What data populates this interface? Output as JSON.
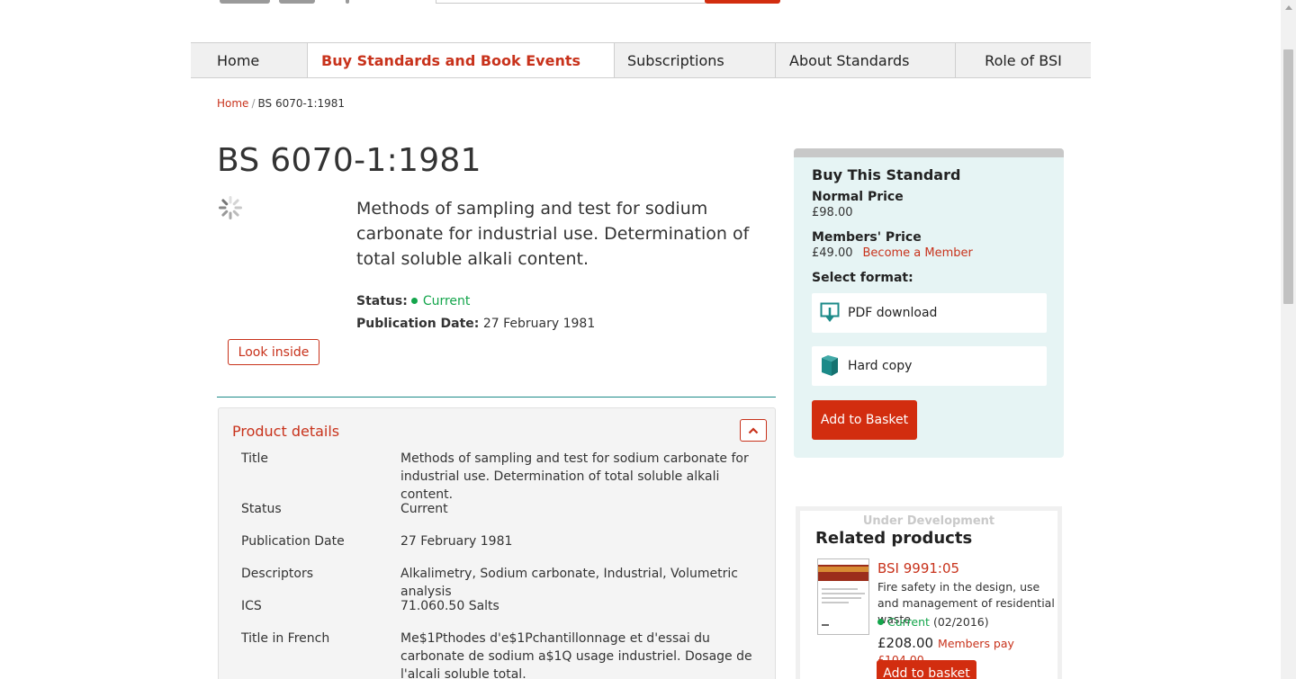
{
  "nav": {
    "items": [
      "Home",
      "Buy Standards and Book Events",
      "Subscriptions",
      "About Standards",
      "Role of BSI"
    ]
  },
  "breadcrumb": {
    "home": "Home",
    "separator": "/",
    "current": "BS 6070-1:1981"
  },
  "product": {
    "code": "BS 6070-1:1981",
    "description": "Methods of sampling and test for sodium carbonate for industrial use. Determination of total soluble alkali content.",
    "status_label": "Status:",
    "status_value": "Current",
    "pub_label": "Publication Date:",
    "pub_value": "27 February 1981",
    "look_inside": "Look inside"
  },
  "details": {
    "heading": "Product details",
    "rows": [
      {
        "key": "Title",
        "value": "Methods of sampling and test for sodium carbonate for industrial use. Determination of total soluble alkali content."
      },
      {
        "key": "Status",
        "value": "Current"
      },
      {
        "key": "Publication Date",
        "value": "27 February 1981"
      },
      {
        "key": "Descriptors",
        "value": "Alkalimetry, Sodium carbonate, Industrial, Volumetric analysis"
      },
      {
        "key": "ICS",
        "value": "71.060.50 Salts"
      },
      {
        "key": "Title in French",
        "value": "Me$1Pthodes d'e$1Pchantillonnage et d'essai du carbonate de sodium a$1Q usage industriel. Dosage de l'alcali soluble total."
      }
    ]
  },
  "buy": {
    "title": "Buy This Standard",
    "normal_label": "Normal Price",
    "normal_price": "£98.00",
    "members_label": "Members' Price",
    "members_price": "£49.00",
    "become_member": "Become a Member",
    "select_format": "Select format:",
    "formats": [
      "PDF download",
      "Hard copy"
    ],
    "add_to_basket": "Add to Basket"
  },
  "related": {
    "under_development": "Under Development",
    "title": "Related products",
    "item": {
      "code": "BSI 9991:05",
      "description": "Fire safety in the design, use and management of residential waste",
      "status": "Current",
      "status_date": "(02/2016)",
      "price": "£208.00",
      "members_pay": "Members pay £104.00",
      "add_to_basket": "Add to basket"
    }
  },
  "colors": {
    "accent": "#c8321b",
    "button": "#d22d0f",
    "status_green": "#13a54b",
    "panel_bg": "#e6f4f4",
    "teal": "#1c8a88"
  }
}
